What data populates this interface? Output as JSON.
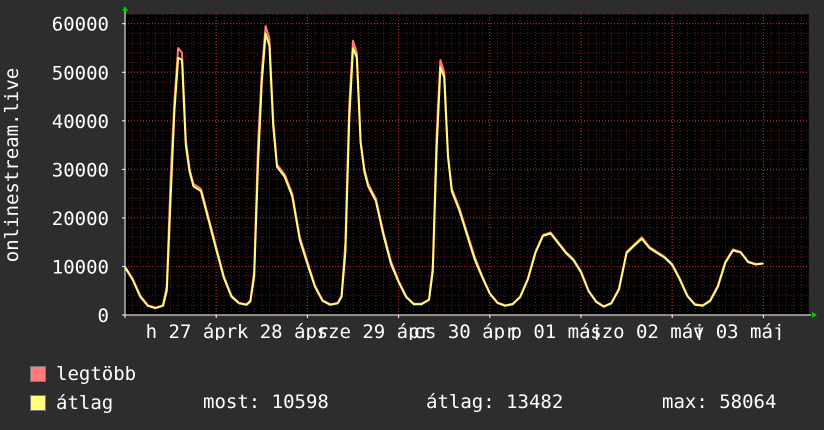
{
  "chart_data": {
    "type": "line",
    "ylabel": "onlinestream.live",
    "ylim": [
      0,
      62000
    ],
    "yticks": [
      0,
      10000,
      20000,
      30000,
      40000,
      50000,
      60000
    ],
    "ytick_labels": [
      "0",
      "10000",
      "20000",
      "30000",
      "40000",
      "50000",
      "60000"
    ],
    "xlim": [
      0,
      180
    ],
    "x_tick_labels": [
      {
        "x": 8,
        "text": "h 27 ápr"
      },
      {
        "x": 32,
        "text": "k 28 ápr"
      },
      {
        "x": 56,
        "text": "sze 29 ápr"
      },
      {
        "x": 80,
        "text": "cs 30 ápr"
      },
      {
        "x": 104,
        "text": "p 01 máj"
      },
      {
        "x": 128,
        "text": "szo 02 máj"
      },
      {
        "x": 152,
        "text": "v 03 máj"
      }
    ],
    "major_x": [
      0,
      24,
      48,
      72,
      96,
      120,
      144,
      168
    ],
    "grid": true,
    "series": [
      {
        "name": "legtöbb",
        "color": "#ff7a7a",
        "x": [
          0,
          2,
          4,
          6,
          8,
          10,
          11,
          12,
          13,
          14,
          15,
          16,
          17,
          18,
          20,
          22,
          24,
          26,
          28,
          30,
          32,
          33,
          34,
          35,
          36,
          37,
          38,
          39,
          40,
          42,
          44,
          46,
          48,
          50,
          52,
          54,
          56,
          57,
          58,
          59,
          60,
          61,
          62,
          63,
          64,
          66,
          68,
          70,
          72,
          74,
          76,
          78,
          80,
          81,
          82,
          83,
          84,
          85,
          86,
          87,
          88,
          90,
          92,
          94,
          96,
          98,
          100,
          102,
          104,
          106,
          108,
          110,
          112,
          114,
          116,
          118,
          120,
          122,
          124,
          126,
          128,
          130,
          132,
          134,
          136,
          138,
          140,
          142,
          144,
          146,
          148,
          150,
          152,
          154,
          156,
          158,
          160,
          162,
          164,
          166,
          168
        ],
        "values": [
          10000,
          7500,
          4000,
          2000,
          1500,
          2000,
          6000,
          28000,
          44000,
          55000,
          54000,
          36000,
          30000,
          27000,
          26000,
          20000,
          14000,
          8000,
          4000,
          2500,
          2200,
          3000,
          9000,
          35000,
          50000,
          59500,
          57000,
          40000,
          31000,
          29000,
          25000,
          16000,
          11000,
          6000,
          3000,
          2200,
          2500,
          4000,
          15000,
          43000,
          56500,
          54000,
          36000,
          30000,
          27000,
          24000,
          17000,
          11000,
          7000,
          3800,
          2300,
          2300,
          3200,
          10000,
          37000,
          52500,
          50000,
          33000,
          26000,
          24000,
          22000,
          17000,
          12000,
          8000,
          4500,
          2600,
          2000,
          2300,
          3800,
          7500,
          13000,
          16500,
          17000,
          15000,
          13000,
          11500,
          9000,
          5000,
          2800,
          1800,
          2500,
          5500,
          13000,
          14500,
          16000,
          14000,
          13000,
          12000,
          10500,
          7500,
          4000,
          2200,
          2000,
          3000,
          6000,
          11000,
          13500,
          13000,
          11000,
          10500,
          10600
        ]
      },
      {
        "name": "átlag",
        "color": "#ffff7a",
        "x": [
          0,
          2,
          4,
          6,
          8,
          10,
          11,
          12,
          13,
          14,
          15,
          16,
          17,
          18,
          20,
          22,
          24,
          26,
          28,
          30,
          32,
          33,
          34,
          35,
          36,
          37,
          38,
          39,
          40,
          42,
          44,
          46,
          48,
          50,
          52,
          54,
          56,
          57,
          58,
          59,
          60,
          61,
          62,
          63,
          64,
          66,
          68,
          70,
          72,
          74,
          76,
          78,
          80,
          81,
          82,
          83,
          84,
          85,
          86,
          87,
          88,
          90,
          92,
          94,
          96,
          98,
          100,
          102,
          104,
          106,
          108,
          110,
          112,
          114,
          116,
          118,
          120,
          122,
          124,
          126,
          128,
          130,
          132,
          134,
          136,
          138,
          140,
          142,
          144,
          146,
          148,
          150,
          152,
          154,
          156,
          158,
          160,
          162,
          164,
          166,
          168
        ],
        "values": [
          9800,
          7300,
          3800,
          1900,
          1400,
          1900,
          5000,
          24000,
          42000,
          53000,
          52500,
          35000,
          29500,
          26500,
          25500,
          19500,
          13500,
          7700,
          3800,
          2400,
          2100,
          2800,
          8000,
          31000,
          48000,
          58000,
          55500,
          39000,
          30500,
          28500,
          24500,
          15500,
          10500,
          5800,
          2900,
          2100,
          2400,
          3800,
          13000,
          40000,
          55000,
          53000,
          35500,
          29500,
          26500,
          23500,
          16500,
          10500,
          6800,
          3700,
          2200,
          2200,
          3100,
          9000,
          34000,
          51000,
          49000,
          32500,
          25500,
          23500,
          21500,
          16500,
          11500,
          7800,
          4400,
          2500,
          1900,
          2200,
          3700,
          7300,
          12800,
          16300,
          16800,
          14800,
          12800,
          11300,
          8800,
          4900,
          2700,
          1700,
          2400,
          5300,
          12800,
          14300,
          15700,
          13800,
          12800,
          11800,
          10300,
          7300,
          3900,
          2100,
          1900,
          2900,
          5800,
          10800,
          13300,
          12900,
          10900,
          10400,
          10598
        ]
      }
    ]
  },
  "legend": {
    "max_label": "legtöbb",
    "avg_label": "átlag",
    "max_color": "#ff7a7a",
    "avg_color": "#ffff7a"
  },
  "stats": {
    "current": "most: 10598",
    "average": "átlag: 13482",
    "maximum": "max: 58064"
  }
}
